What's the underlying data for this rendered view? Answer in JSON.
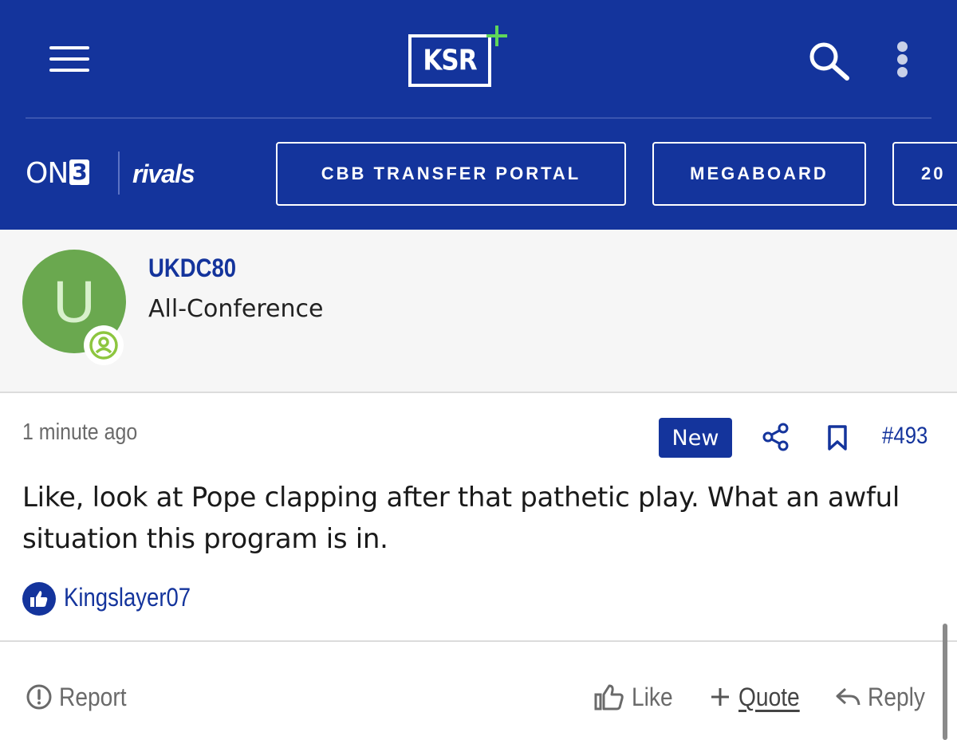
{
  "header": {
    "logo_text": "KSR",
    "network_brand_left": "ON",
    "network_brand_digit": "3",
    "network_brand_right": "rivals",
    "nav_pills": [
      "CBB TRANSFER PORTAL",
      "MEGABOARD",
      "20"
    ]
  },
  "user": {
    "avatar_letter": "U",
    "username": "UKDC80",
    "title": "All-Conference"
  },
  "post": {
    "timestamp": "1 minute ago",
    "badge": "New",
    "number": "#493",
    "body": "Like, look at Pope clapping after that pathetic play. What an awful situation this program is in.",
    "liked_by": "Kingslayer07"
  },
  "actions": {
    "report": "Report",
    "like": "Like",
    "quote": "Quote",
    "reply": "Reply"
  },
  "colors": {
    "brand_blue": "#14349c",
    "plus_green": "#5fd65a",
    "avatar_green": "#6aa84f",
    "badge_green": "#8dc63f"
  },
  "icons": [
    "menu-icon",
    "search-icon",
    "more-vertical-icon",
    "user-badge-icon",
    "share-icon",
    "bookmark-icon",
    "thumbs-up-icon",
    "alert-circle-icon",
    "plus-icon",
    "reply-arrow-icon"
  ]
}
